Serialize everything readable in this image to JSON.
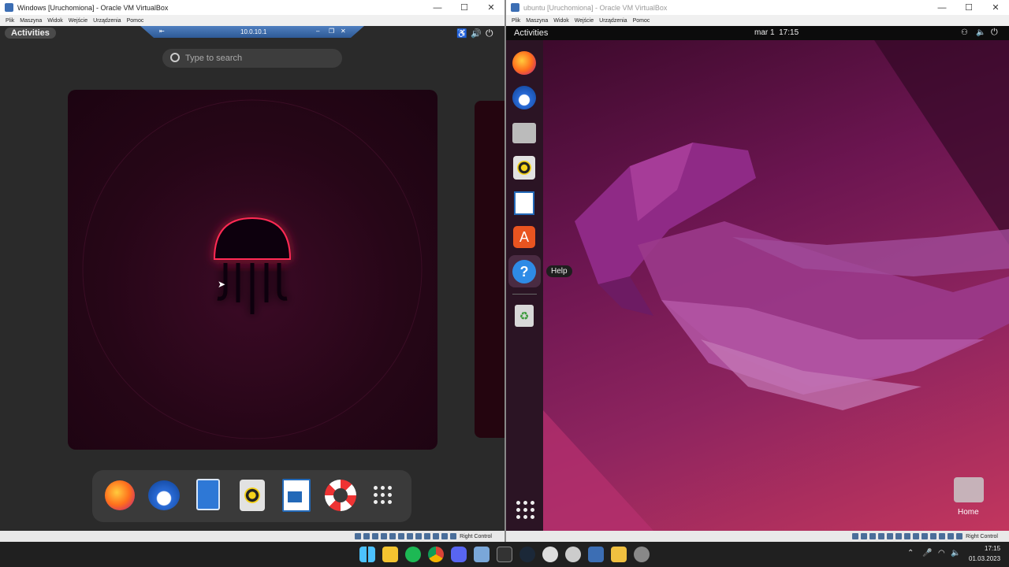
{
  "left_window": {
    "title": "Windows [Uruchomiona] - Oracle VM VirtualBox",
    "menu": [
      "Plik",
      "Maszyna",
      "Widok",
      "Wejście",
      "Urządzenia",
      "Pomoc"
    ],
    "top_bar": {
      "activities": "Activities"
    },
    "remote_bar": {
      "address": "10.0.10.1"
    },
    "search": {
      "placeholder": "Type to search"
    },
    "dock": [
      "firefox-icon",
      "thunderbird-icon",
      "files-icon",
      "rhythmbox-icon",
      "writer-icon",
      "help-icon",
      "show-apps-icon"
    ],
    "status": {
      "host_key": "Right Control"
    }
  },
  "right_window": {
    "title": "ubuntu [Uruchomiona] - Oracle VM VirtualBox",
    "menu": [
      "Plik",
      "Maszyna",
      "Widok",
      "Wejście",
      "Urządzenia",
      "Pomoc"
    ],
    "top_bar": {
      "activities": "Activities",
      "clock": "mar 1  17:15"
    },
    "dock": [
      "firefox-icon",
      "thunderbird-icon",
      "files-icon",
      "rhythmbox-icon",
      "writer-icon",
      "software-icon",
      "help-icon",
      "trash-icon"
    ],
    "tooltip": "Help",
    "desktop": {
      "home_label": "Home"
    },
    "status": {
      "host_key": "Right Control"
    }
  },
  "taskbar": {
    "apps": [
      "windows-start-icon",
      "file-explorer-icon",
      "spotify-icon",
      "chrome-icon",
      "discord-icon",
      "photos-icon",
      "terminal-icon",
      "steam-icon",
      "obs-icon",
      "tw-icon",
      "virtualbox-icon",
      "notes-icon",
      "settings-icon"
    ],
    "time": "17:15",
    "date": "01.03.2023"
  },
  "colors": {
    "ubuntu_bg": "#7a1d5c",
    "overview_bg": "#2b2b2b",
    "accent": "#e95420"
  }
}
